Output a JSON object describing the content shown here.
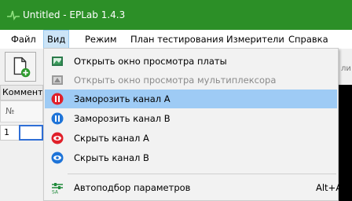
{
  "window": {
    "title": "Untitled - EPLab 1.4.3"
  },
  "menubar": {
    "items": [
      {
        "label": "Файл"
      },
      {
        "label": "Вид"
      },
      {
        "label": "Режим"
      },
      {
        "label": "План тестирования"
      },
      {
        "label": "Измерители"
      },
      {
        "label": "Справка"
      }
    ]
  },
  "toolbar": {
    "right_text": "ли"
  },
  "sidebar": {
    "comment_label": "Комментарий",
    "column_header": "№",
    "row_number": "1"
  },
  "view_menu": {
    "items": [
      {
        "label": "Открыть окно просмотра платы",
        "icon": "board-view-icon",
        "enabled": true
      },
      {
        "label": "Открыть окно просмотра мультиплексора",
        "icon": "multiplexer-view-icon",
        "enabled": false
      },
      {
        "label": "Заморозить канал A",
        "icon": "pause-red-icon",
        "enabled": true
      },
      {
        "label": "Заморозить канал B",
        "icon": "pause-blue-icon",
        "enabled": true
      },
      {
        "label": "Скрыть канал A",
        "icon": "eye-red-icon",
        "enabled": true
      },
      {
        "label": "Скрыть канал B",
        "icon": "eye-blue-icon",
        "enabled": true
      },
      {
        "label": "Автоподбор параметров",
        "icon": "auto-params-icon",
        "enabled": true,
        "shortcut": "Alt+A"
      }
    ],
    "highlighted_item": "Заморозить канал A"
  },
  "colors": {
    "titlebar": "#2c8f27",
    "menu_highlight": "#9ecbf5",
    "channel_a": "#e0202a",
    "channel_b": "#1e74d8"
  }
}
